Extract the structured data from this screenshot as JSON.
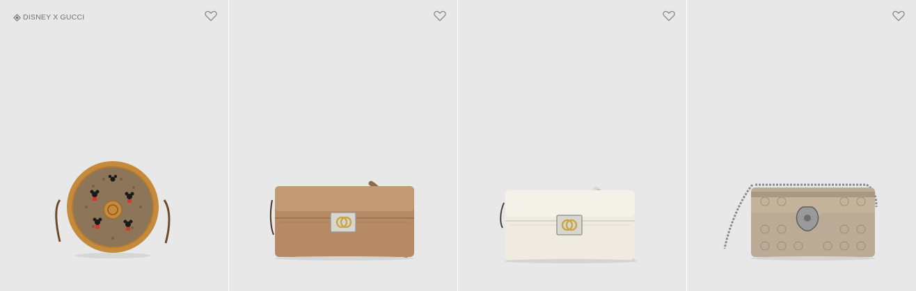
{
  "products": [
    {
      "badge": "DISNEY X GUCCI",
      "name": "disney-mickey-round-shoulder-bag"
    },
    {
      "badge": "",
      "name": "brown-leather-wallet-on-strap"
    },
    {
      "badge": "",
      "name": "white-leather-wallet-on-strap"
    },
    {
      "badge": "",
      "name": "dionysus-gg-supreme-mini-bag"
    }
  ],
  "icons": {
    "wishlist": "heart-outline-icon",
    "badge": "diamond-icon"
  },
  "colors": {
    "background": "#e8e8e8",
    "divider": "#ffffff",
    "text_muted": "#6f6f6f"
  }
}
